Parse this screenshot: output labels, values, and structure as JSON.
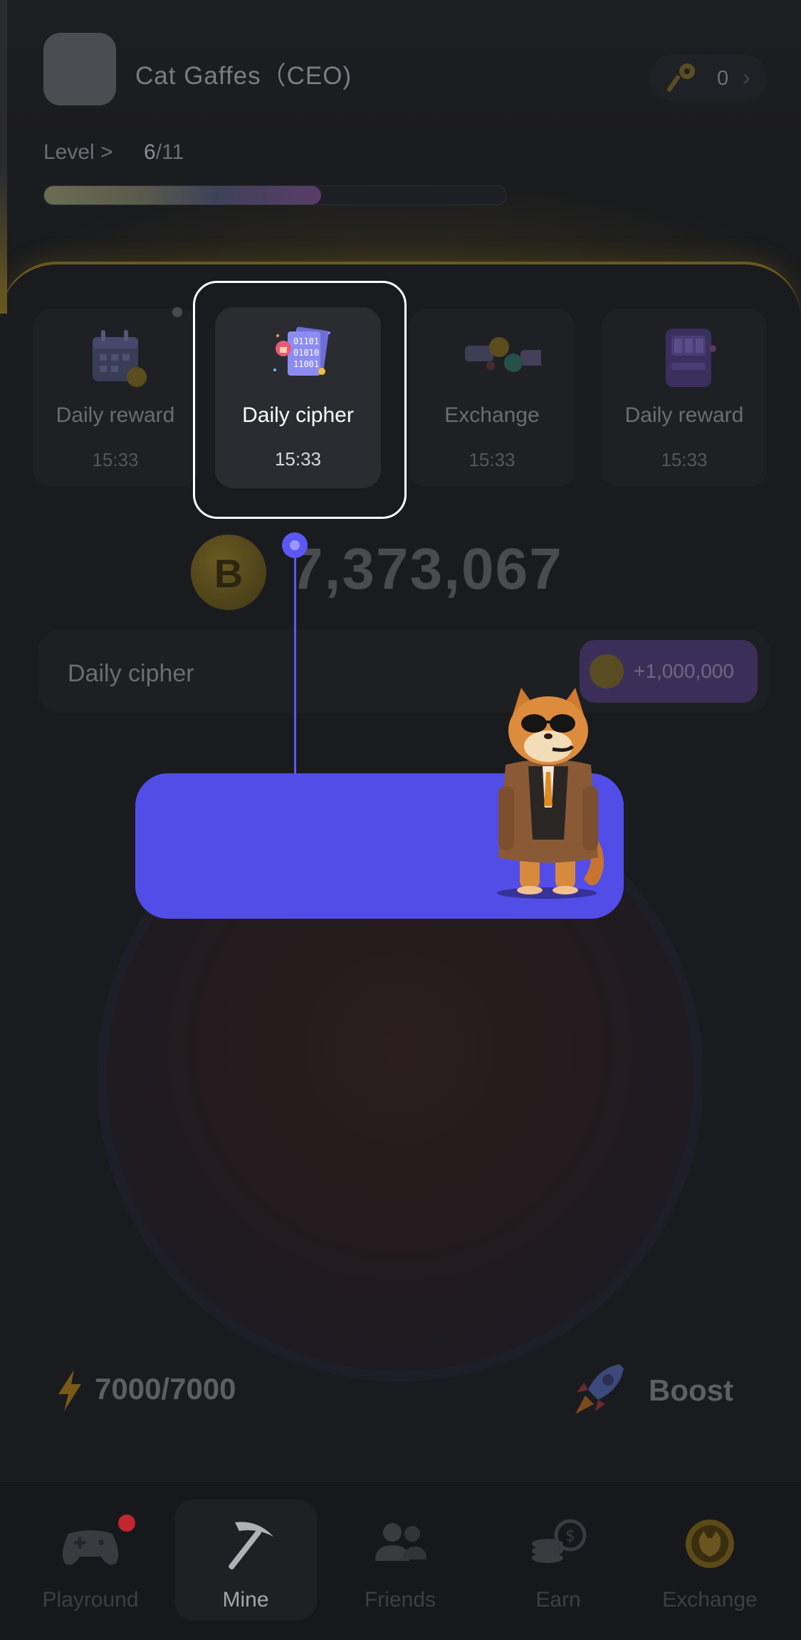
{
  "header": {
    "username": "Cat Gaffes（CEO)",
    "keys_count": "0",
    "level_label": "Level >",
    "level_current": "6",
    "level_total": "/11",
    "level_progress": 0.6
  },
  "cards": [
    {
      "title": "Daily reward",
      "time": "15:33",
      "icon": "calendar-icon"
    },
    {
      "title": "Daily cipher",
      "time": "15:33",
      "icon": "cipher-icon"
    },
    {
      "title": "Exchange",
      "time": "15:33",
      "icon": "handshake-icon"
    },
    {
      "title": "Daily reward",
      "time": "15:33",
      "icon": "slot-machine-icon"
    }
  ],
  "balance": {
    "coin_symbol": "B",
    "amount": "7,373,067"
  },
  "cipher_bar": {
    "label": "Daily cipher",
    "reward": "+1,000,000"
  },
  "stats": {
    "energy": "7000/7000",
    "boost_label": "Boost"
  },
  "nav": [
    {
      "label": "Playround",
      "icon": "gamepad-icon",
      "badge": true
    },
    {
      "label": "Mine",
      "icon": "pickaxe-icon",
      "active": true
    },
    {
      "label": "Friends",
      "icon": "friends-icon"
    },
    {
      "label": "Earn",
      "icon": "coins-icon"
    },
    {
      "label": "Exchange",
      "icon": "exchange-coin-icon"
    }
  ],
  "colors": {
    "accent": "#534de8",
    "gold_border": "#6b5a1e",
    "badge": "#c2262e"
  }
}
